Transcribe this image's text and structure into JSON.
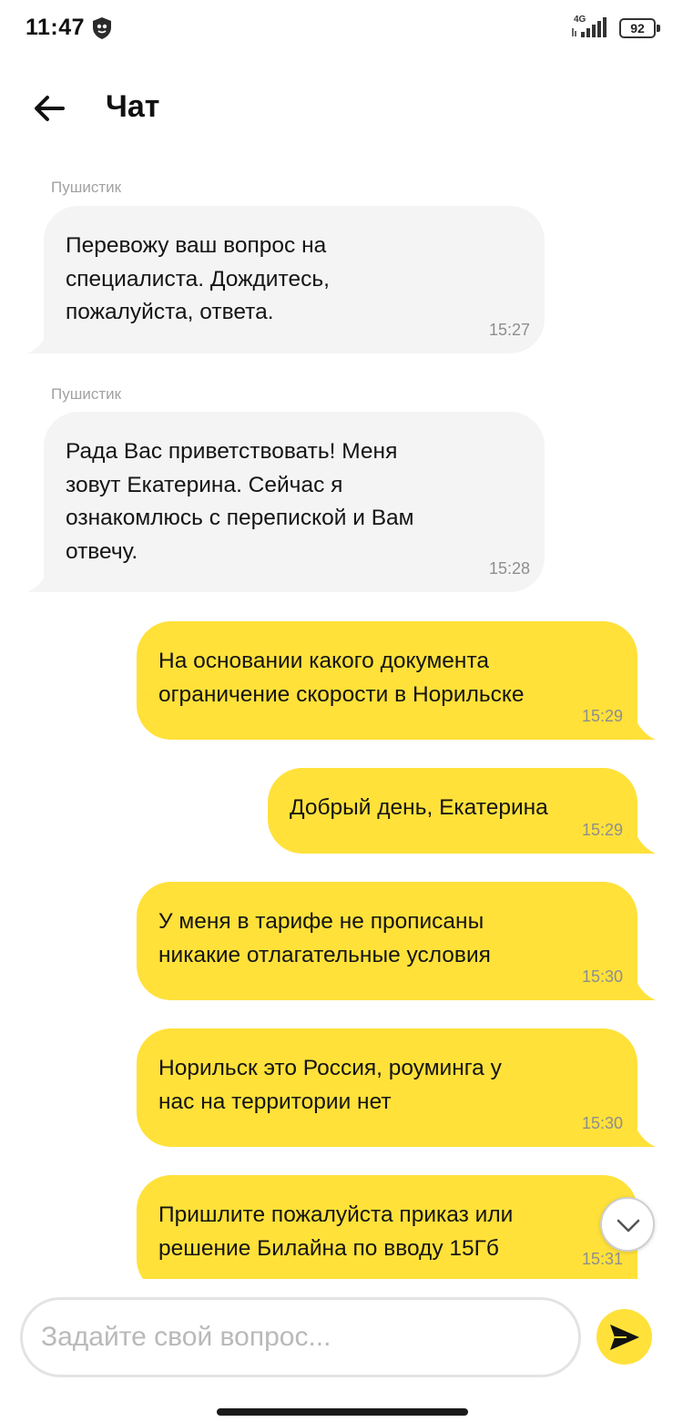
{
  "status_bar": {
    "time": "11:47",
    "network": "4G",
    "battery": "92",
    "icons": [
      "shield-icon",
      "signal-icon",
      "battery-icon"
    ]
  },
  "header": {
    "title": "Чат",
    "back_icon": "arrow-left-icon"
  },
  "messages": [
    {
      "direction": "incoming",
      "sender": "Пушистик",
      "text": "Перевожу ваш вопрос на\nспециалиста. Дождитесь,\nпожалуйста, ответа.",
      "time": "15:27"
    },
    {
      "direction": "incoming",
      "sender": "Пушистик",
      "text": "Рада Вас приветствовать! Меня\nзовут Екатерина. Сейчас я\nознакомлюсь с перепиской и Вам\nотвечу.",
      "time": "15:28"
    },
    {
      "direction": "outgoing",
      "text": "На основании какого документа\nограничение скорости в Норильске",
      "time": "15:29"
    },
    {
      "direction": "outgoing",
      "text": "Добрый день, Екатерина",
      "time": "15:29"
    },
    {
      "direction": "outgoing",
      "text": "У меня в тарифе не прописаны\nникакие отлагательные условия",
      "time": "15:30"
    },
    {
      "direction": "outgoing",
      "text": "Норильск это Россия, роуминга у\nнас на территории нет",
      "time": "15:30"
    },
    {
      "direction": "outgoing",
      "text": "Пришлите пожалуйста приказ или\nрешение Билайна по вводу 15Гб",
      "time": "15:31"
    }
  ],
  "scroll_down_icon": "chevron-down-icon",
  "composer": {
    "placeholder": "Задайте свой вопрос...",
    "value": "",
    "send_icon": "send-icon"
  },
  "colors": {
    "outgoing_bubble": "#ffe13a",
    "incoming_bubble": "#f4f4f4",
    "send_button": "#ffe13a"
  }
}
